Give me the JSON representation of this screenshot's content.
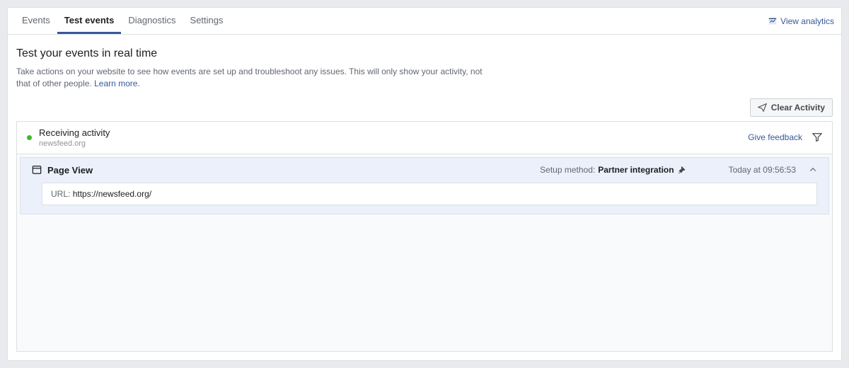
{
  "tabs": {
    "events": "Events",
    "test_events": "Test events",
    "diagnostics": "Diagnostics",
    "settings": "Settings"
  },
  "view_analytics": "View analytics",
  "header": {
    "title": "Test your events in real time",
    "description": "Take actions on your website to see how events are set up and troubleshoot any issues. This will only show your activity, not that of other people.",
    "learn_more": "Learn more."
  },
  "toolbar": {
    "clear_activity": "Clear Activity"
  },
  "panel": {
    "status": "Receiving activity",
    "domain": "newsfeed.org",
    "feedback": "Give feedback"
  },
  "event": {
    "name": "Page View",
    "setup_label": "Setup method:",
    "setup_value": "Partner integration",
    "timestamp": "Today at 09:56:53",
    "url_label": "URL:",
    "url_value": "https://newsfeed.org/"
  }
}
